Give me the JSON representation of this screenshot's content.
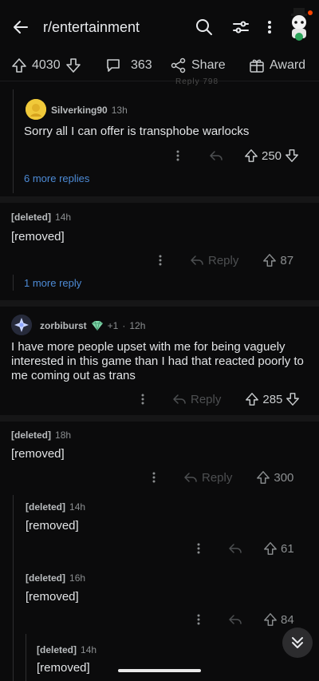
{
  "header": {
    "title": "r/entertainment"
  },
  "actions": {
    "votes": "4030",
    "comments": "363",
    "share": "Share",
    "award": "Award"
  },
  "ghost_text": "Reply   798",
  "comments": [
    {
      "user": "Silverking90",
      "time": "13h",
      "body": "Sorry all I can offer is transphobe warlocks",
      "votes": "250",
      "more": "6 more replies"
    },
    {
      "user": "[deleted]",
      "time": "14h",
      "body": "[removed]",
      "reply": "Reply",
      "votes": "87",
      "more": "1 more reply"
    },
    {
      "user": "zorbiburst",
      "flair": "+1",
      "time": "12h",
      "body": "I have more people upset with me for being vaguely interested in this game than I had that reacted poorly to me coming out as trans",
      "reply": "Reply",
      "votes": "285"
    },
    {
      "user": "[deleted]",
      "time": "18h",
      "body": "[removed]",
      "reply": "Reply",
      "votes": "300"
    },
    {
      "user": "[deleted]",
      "time": "14h",
      "body": "[removed]",
      "votes": "61"
    },
    {
      "user": "[deleted]",
      "time": "16h",
      "body": "[removed]",
      "votes": "84"
    },
    {
      "user": "[deleted]",
      "time": "14h",
      "body": "[removed]"
    }
  ],
  "colors": {
    "background": "#0b0b0c",
    "link": "#4d8bd6",
    "text": "#e2e4e6"
  }
}
